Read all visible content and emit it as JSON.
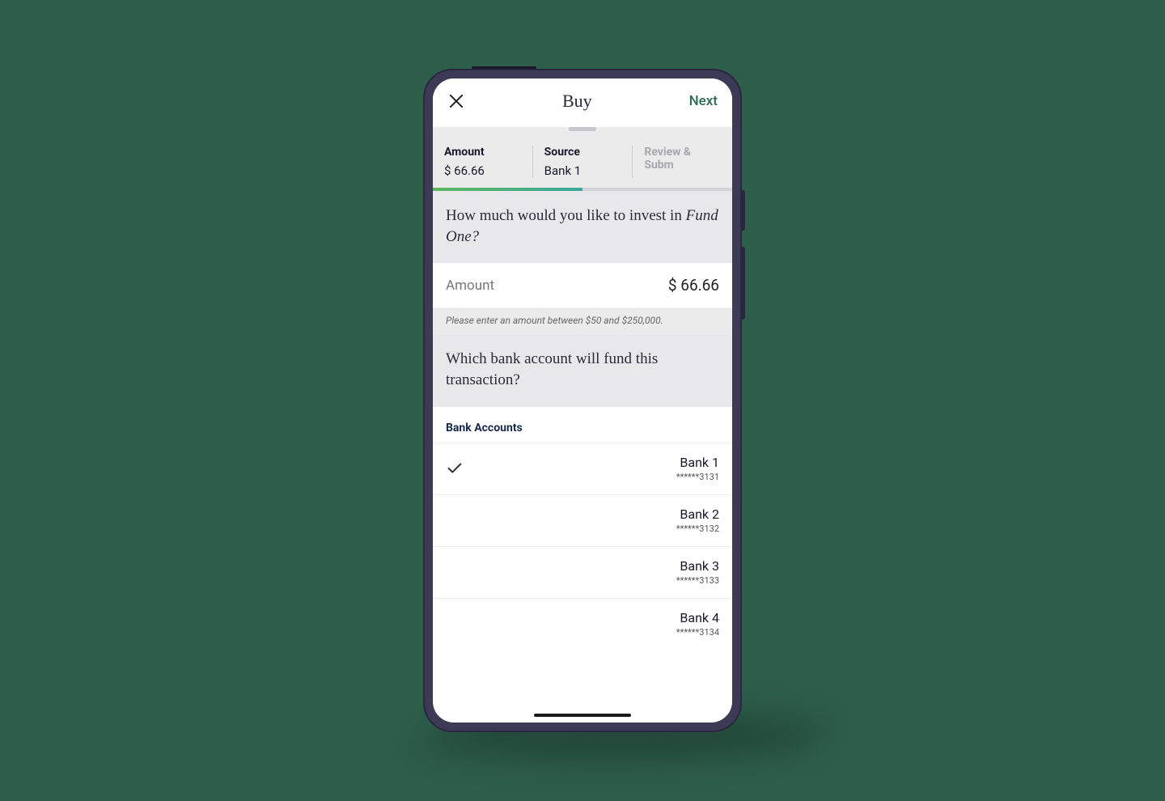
{
  "nav": {
    "title": "Buy",
    "next": "Next"
  },
  "steps": {
    "amount": {
      "label": "Amount",
      "value": "$ 66.66"
    },
    "source": {
      "label": "Source",
      "value": "Bank 1"
    },
    "review": {
      "label": "Review & Subm"
    }
  },
  "question1_prefix": "How much would you like to invest in ",
  "fund_name": "Fund One?",
  "amount_row": {
    "label": "Amount",
    "value": "$ 66.66"
  },
  "hint": "Please enter an amount between $50 and $250,000.",
  "question2": "Which bank account will fund this transaction?",
  "bank_heading": "Bank Accounts",
  "banks": [
    {
      "name": "Bank 1",
      "acct": "******3131",
      "selected": true
    },
    {
      "name": "Bank 2",
      "acct": "******3132",
      "selected": false
    },
    {
      "name": "Bank 3",
      "acct": "******3133",
      "selected": false
    },
    {
      "name": "Bank 4",
      "acct": "******3134",
      "selected": false
    }
  ]
}
